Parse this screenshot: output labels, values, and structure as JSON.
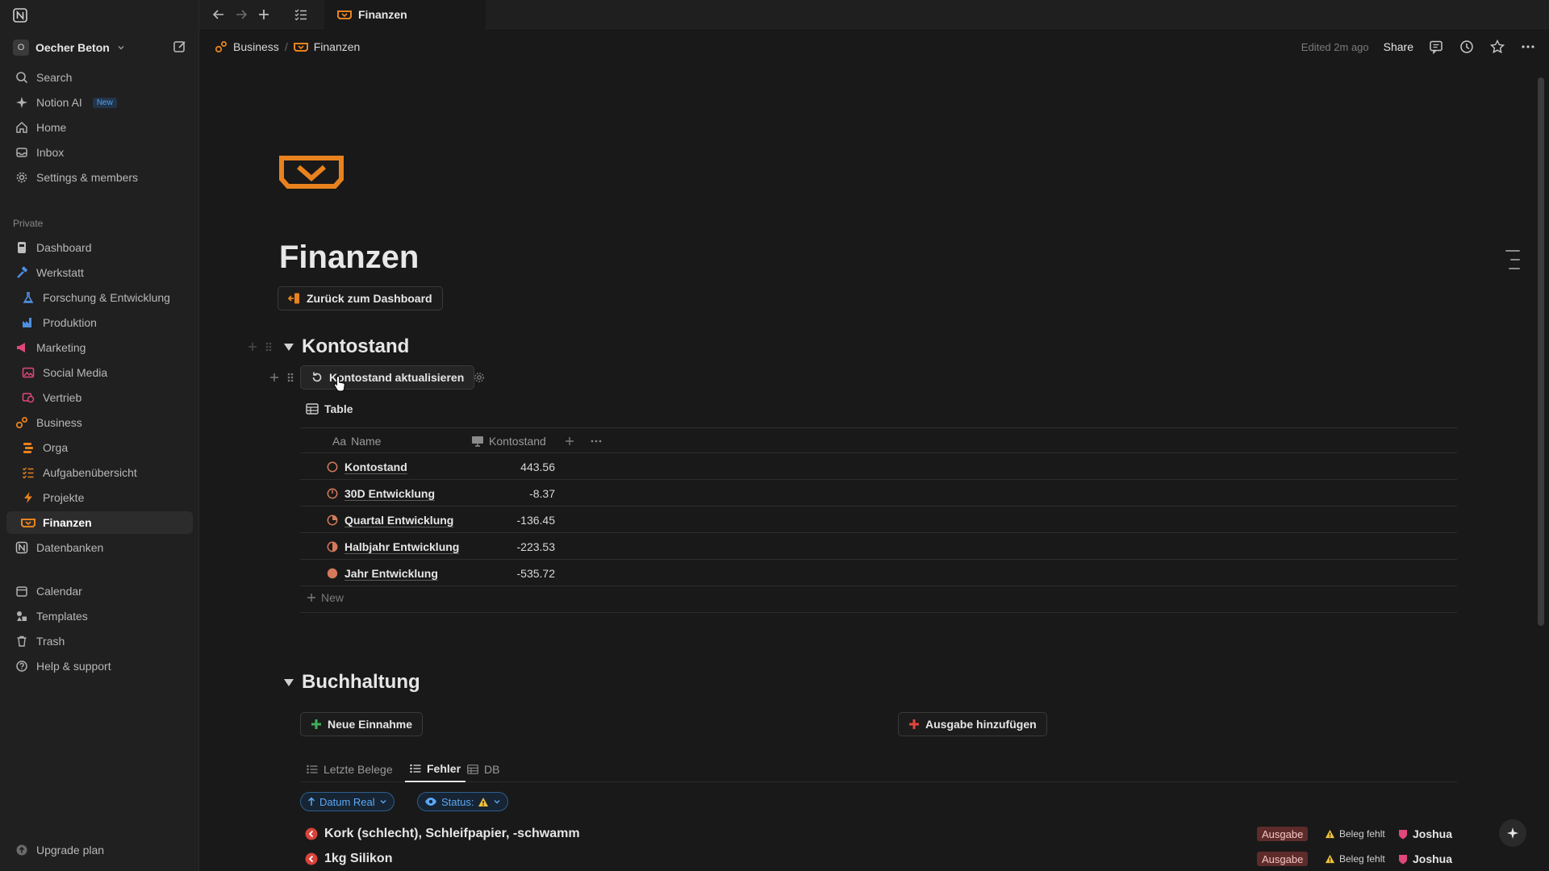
{
  "sidebar": {
    "workspace": {
      "initial": "O",
      "name": "Oecher Beton"
    },
    "top_items": [
      {
        "label": "Search",
        "icon": "search-icon"
      },
      {
        "label": "Notion AI",
        "icon": "sparkle-icon",
        "badge": "New"
      },
      {
        "label": "Home",
        "icon": "home-icon"
      },
      {
        "label": "Inbox",
        "icon": "inbox-icon"
      },
      {
        "label": "Settings & members",
        "icon": "gear-icon"
      }
    ],
    "section_label": "Private",
    "pages": [
      {
        "label": "Dashboard",
        "icon": "dashboard-icon"
      },
      {
        "label": "Werkstatt",
        "icon": "hammer-icon"
      },
      {
        "label": "Forschung & Entwicklung",
        "icon": "flask-icon"
      },
      {
        "label": "Produktion",
        "icon": "factory-icon"
      },
      {
        "label": "Marketing",
        "icon": "megaphone-icon"
      },
      {
        "label": "Social Media",
        "icon": "image-icon"
      },
      {
        "label": "Vertrieb",
        "icon": "sales-icon"
      },
      {
        "label": "Business",
        "icon": "gears-icon"
      },
      {
        "label": "Orga",
        "icon": "stack-icon"
      },
      {
        "label": "Aufgabenübersicht",
        "icon": "checklist-icon"
      },
      {
        "label": "Projekte",
        "icon": "lightning-icon"
      },
      {
        "label": "Finanzen",
        "icon": "cashbox-icon"
      },
      {
        "label": "Datenbanken",
        "icon": "notion-icon"
      }
    ],
    "bottom_items": [
      {
        "label": "Calendar",
        "icon": "calendar-icon"
      },
      {
        "label": "Templates",
        "icon": "templates-icon"
      },
      {
        "label": "Trash",
        "icon": "trash-icon"
      },
      {
        "label": "Help & support",
        "icon": "help-icon"
      }
    ],
    "upgrade": "Upgrade plan"
  },
  "tabbar": {
    "tab_label": "Finanzen"
  },
  "breadcrumbs": [
    "Business",
    "Finanzen"
  ],
  "topbar": {
    "edited": "Edited 2m ago",
    "share": "Share"
  },
  "page": {
    "title": "Finanzen",
    "back_button": "Zurück zum Dashboard",
    "section1": {
      "heading": "Kontostand",
      "refresh_button": "Kontostand aktualisieren",
      "view_label": "Table",
      "columns": [
        "Name",
        "Kontostand"
      ],
      "col_prefix": "Aa",
      "rows": [
        {
          "name": "Kontostand",
          "value": "443.56",
          "icon": "circle-empty-icon"
        },
        {
          "name": "30D Entwicklung",
          "value": "-8.37",
          "icon": "circle-quarter-icon"
        },
        {
          "name": "Quartal Entwicklung",
          "value": "-136.45",
          "icon": "circle-quarter-filled-icon"
        },
        {
          "name": "Halbjahr Entwicklung",
          "value": "-223.53",
          "icon": "circle-half-icon"
        },
        {
          "name": "Jahr Entwicklung",
          "value": "-535.72",
          "icon": "circle-full-icon"
        }
      ],
      "new_row": "New"
    },
    "section2": {
      "heading": "Buchhaltung",
      "btn_income": "Neue Einnahme",
      "btn_expense": "Ausgabe hinzufügen",
      "tabs": [
        "Letzte Belege",
        "Fehler",
        "DB"
      ],
      "filter_sort": "Datum Real",
      "filter_status": "Status:",
      "items": [
        {
          "title": "Kork (schlecht), Schleifpapier, -schwamm",
          "tag": "Ausgabe",
          "warning": "Beleg fehlt",
          "person": "Joshua"
        },
        {
          "title": "1kg Silikon",
          "tag": "Ausgabe",
          "warning": "Beleg fehlt",
          "person": "Joshua"
        }
      ]
    }
  },
  "colors": {
    "accent_orange": "#e8821e",
    "link_blue": "#5aa9f5",
    "tag_red": "#5e2b2b"
  }
}
